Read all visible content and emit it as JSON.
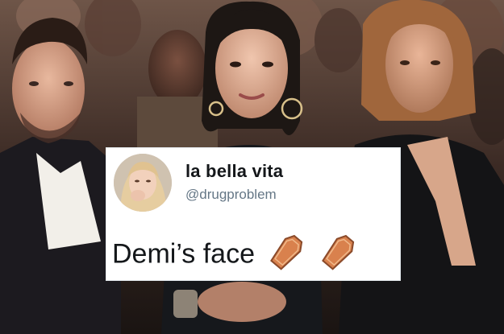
{
  "tweet": {
    "display_name": "la bella vita",
    "handle": "@drugproblem",
    "text": "Demi’s face",
    "emoji": [
      "coffin-icon",
      "coffin-icon"
    ]
  },
  "colors": {
    "card_background": "#ffffff",
    "name_color": "#14171a",
    "handle_color": "#657786",
    "coffin_wood": "#d9814d",
    "coffin_trim": "#8a4a2a"
  }
}
